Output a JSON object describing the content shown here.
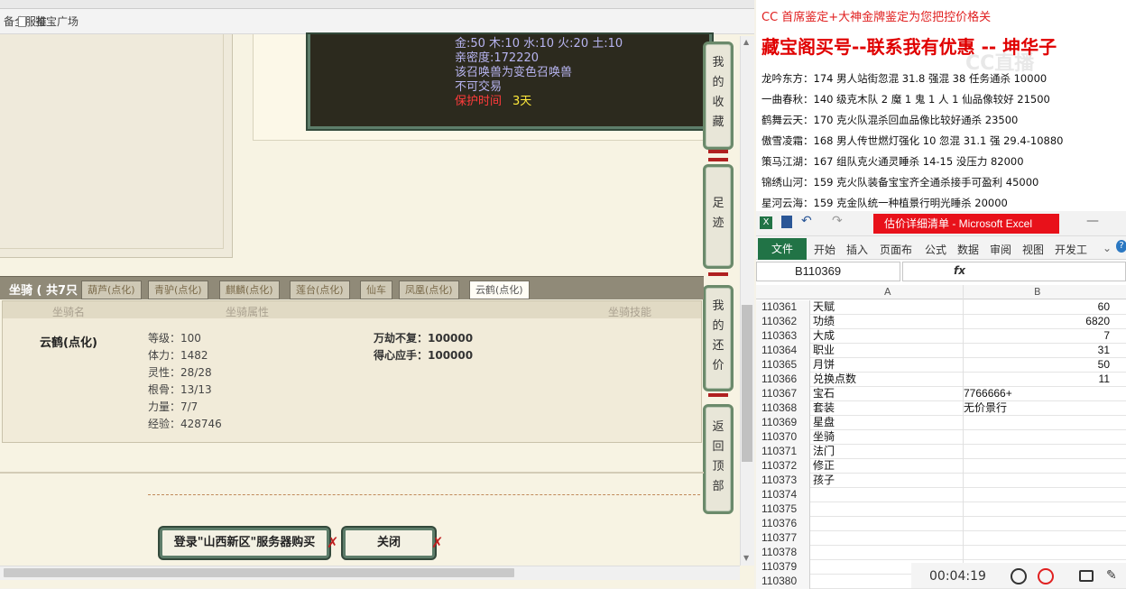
{
  "browser": {
    "bookmarks": [
      "备全服推",
      "鉴宝广场"
    ]
  },
  "pet": {
    "line1": "金:50 木:10 水:10 火:20 土:10",
    "line2": "亲密度:172220",
    "line3": "该召唤兽为变色召唤兽",
    "line4": "不可交易",
    "protect_label": "保护时间",
    "protect_value": "3天"
  },
  "side_buttons": {
    "favorites": "我的收藏",
    "footprint": "足迹",
    "my_offer": "我的还价",
    "back_top": "返回顶部"
  },
  "mount": {
    "title": "坐骑 ( 共7只",
    "tabs": [
      "葫芦(点化)",
      "青驴(点化)",
      "麒麟(点化)",
      "莲台(点化)",
      "仙车",
      "凤凰(点化)",
      "云鹤(点化)"
    ],
    "active_tab": "云鹤(点化)",
    "headers": [
      "坐骑名",
      "坐骑属性",
      "坐骑技能"
    ],
    "name": "云鹤(点化)",
    "attributes": [
      "等级：100",
      "体力：1482",
      "灵性：28/28",
      "根骨：13/13",
      "力量：7/7",
      "经验：428746"
    ],
    "skills": [
      "万劫不复：100000",
      "得心应手：100000"
    ]
  },
  "actions": {
    "login_buy": "登录\"山西新区\"服务器购买",
    "close": "关闭"
  },
  "doc": {
    "line1": "CC 首席鉴定+大神金牌鉴定为您把控价格关",
    "line2": "藏宝阁买号--联系我有优惠 -- 坤华子",
    "rows": [
      "龙吟东方：174 男人站街忽混 31.8 强混 38 任务通杀 10000",
      "一曲春秋：140 级克木队 2 魔 1 鬼 1 人 1 仙品像较好 21500",
      "鹤舞云天：170 克火队混杀回血品像比较好通杀 23500",
      "傲雪凌霜：168 男人传世燃灯强化 10 忽混 31.1 强 29.4-10880",
      "策马江湖：167 组队克火通灵睡杀 14-15 没压力 82000",
      "锦绣山河：159 克火队装备宝宝齐全通杀接手可盈利 45000",
      "星河云海：159 克金队统一种植景行明光睡杀 20000"
    ],
    "watermark": "CC直播"
  },
  "excel": {
    "title": "估价详细清单 - Microsoft Excel",
    "file_tab": "文件",
    "ribbon_tabs": [
      "开始",
      "插入",
      "页面布",
      "公式",
      "数据",
      "审阅",
      "视图",
      "开发工"
    ],
    "namebox": "B110369",
    "fx": "fx",
    "col_a": "A",
    "col_b": "B",
    "rows": [
      {
        "n": "110361",
        "a": "天赋",
        "b": "60",
        "num": true
      },
      {
        "n": "110362",
        "a": "功绩",
        "b": "6820",
        "num": true
      },
      {
        "n": "110363",
        "a": "大成",
        "b": "7",
        "num": true
      },
      {
        "n": "110364",
        "a": "职业",
        "b": "31",
        "num": true
      },
      {
        "n": "110365",
        "a": "月饼",
        "b": "50",
        "num": true
      },
      {
        "n": "110366",
        "a": "兑换点数",
        "b": "11",
        "num": true
      },
      {
        "n": "110367",
        "a": "宝石",
        "b": "7766666+",
        "num": false
      },
      {
        "n": "110368",
        "a": "套装",
        "b": "无价景行",
        "num": false
      },
      {
        "n": "110369",
        "a": "星盘",
        "b": "",
        "num": false
      },
      {
        "n": "110370",
        "a": "坐骑",
        "b": "",
        "num": false
      },
      {
        "n": "110371",
        "a": "法门",
        "b": "",
        "num": false
      },
      {
        "n": "110372",
        "a": "修正",
        "b": "",
        "num": false
      },
      {
        "n": "110373",
        "a": "孩子",
        "b": "",
        "num": false
      },
      {
        "n": "110374",
        "a": "",
        "b": "",
        "num": false
      },
      {
        "n": "110375",
        "a": "",
        "b": "",
        "num": false
      },
      {
        "n": "110376",
        "a": "",
        "b": "",
        "num": false
      },
      {
        "n": "110377",
        "a": "",
        "b": "",
        "num": false
      },
      {
        "n": "110378",
        "a": "",
        "b": "",
        "num": false
      },
      {
        "n": "110379",
        "a": "",
        "b": "",
        "num": false
      },
      {
        "n": "110380",
        "a": "",
        "b": "",
        "num": false
      }
    ]
  },
  "recorder": {
    "time": "00:04:19"
  }
}
